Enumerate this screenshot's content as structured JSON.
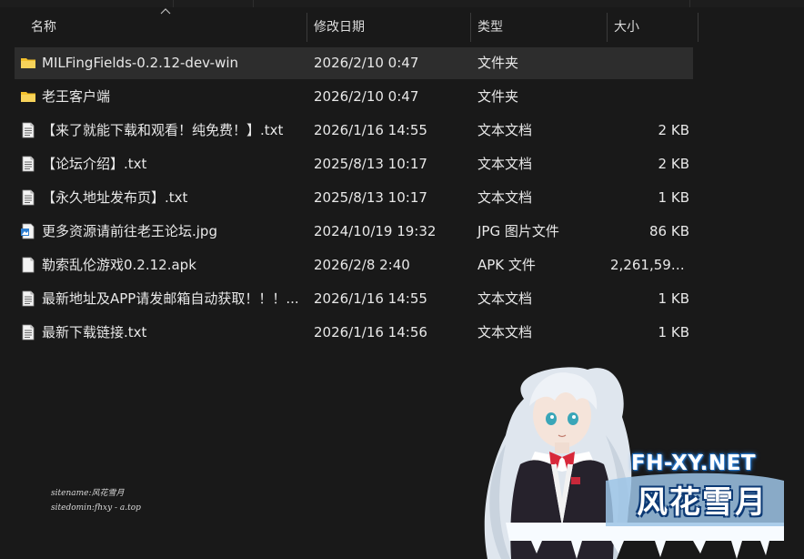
{
  "columns": {
    "name": "名称",
    "date": "修改日期",
    "type": "类型",
    "size": "大小"
  },
  "files": [
    {
      "icon": "folder-icon",
      "name": "MILFingFields-0.2.12-dev-win",
      "date": "2026/2/10 0:47",
      "type": "文件夹",
      "size": "",
      "selected": true
    },
    {
      "icon": "folder-icon",
      "name": "老王客户端",
      "date": "2026/2/10 0:47",
      "type": "文件夹",
      "size": ""
    },
    {
      "icon": "text-file-icon",
      "name": "【来了就能下载和观看！纯免费！】.txt",
      "date": "2026/1/16 14:55",
      "type": "文本文档",
      "size": "2 KB"
    },
    {
      "icon": "text-file-icon",
      "name": "【论坛介绍】.txt",
      "date": "2025/8/13 10:17",
      "type": "文本文档",
      "size": "2 KB"
    },
    {
      "icon": "text-file-icon",
      "name": "【永久地址发布页】.txt",
      "date": "2025/8/13 10:17",
      "type": "文本文档",
      "size": "1 KB"
    },
    {
      "icon": "image-file-icon",
      "name": "更多资源请前往老王论坛.jpg",
      "date": "2024/10/19 19:32",
      "type": "JPG 图片文件",
      "size": "86 KB"
    },
    {
      "icon": "blank-file-icon",
      "name": "勒索乱伦游戏0.2.12.apk",
      "date": "2026/2/8 2:40",
      "type": "APK 文件",
      "size": "2,261,599..."
    },
    {
      "icon": "text-file-icon",
      "name": "最新地址及APP请发邮箱自动获取！！！...",
      "date": "2026/1/16 14:55",
      "type": "文本文档",
      "size": "1 KB"
    },
    {
      "icon": "text-file-icon",
      "name": "最新下载链接.txt",
      "date": "2026/1/16 14:56",
      "type": "文本文档",
      "size": "1 KB"
    }
  ],
  "watermark": {
    "sitename": "sitename:风花雪月",
    "sitedomain": "sitedomin:fhxy - a.top",
    "site_url": "FH-XY.NET",
    "logo_text": "风花雪月"
  },
  "colors": {
    "background": "#191919",
    "selected_row": "#2d2d2d",
    "folder": "#f3c12c",
    "text": "#e8e8e8"
  }
}
